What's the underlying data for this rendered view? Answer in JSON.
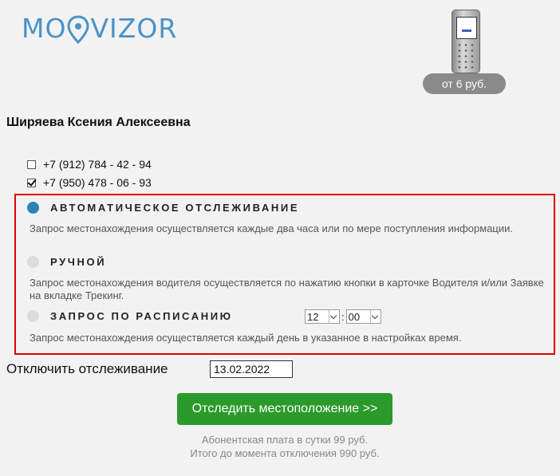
{
  "brand": {
    "logo_text_pre": "MO",
    "logo_text_post": "VIZOR"
  },
  "promo": {
    "price_badge": "от 6 руб."
  },
  "person": {
    "name": "Ширяева Ксения Алексеевна"
  },
  "phones": [
    {
      "number": "+7 (912) 784 - 42 - 94",
      "checked": false
    },
    {
      "number": "+7 (950) 478 - 06 - 93",
      "checked": true
    }
  ],
  "modes": {
    "auto": {
      "title": "АВТОМАТИЧЕСКОЕ ОТСЛЕЖИВАНИЕ",
      "desc": "Запрос местонахождения осуществляется каждые два часа или по мере поступления информации.",
      "selected": true
    },
    "manual": {
      "title": "РУЧНОЙ",
      "desc": "Запрос местонахождения водителя осуществляется по нажатию кнопки в карточке Водителя и/или Заявке на вкладке Трекинг.",
      "selected": false
    },
    "schedule": {
      "title": "ЗАПРОС ПО РАСПИСАНИЮ",
      "desc": "Запрос местонахождения осуществляется каждый день в указанное в настройках время.",
      "selected": false,
      "hour": "12",
      "minute": "00",
      "separator": ":"
    }
  },
  "disable": {
    "label": "Отключить отслеживание",
    "date": "13.02.2022"
  },
  "action": {
    "button_label": "Отследить местоположение >>"
  },
  "fees": {
    "daily": "Абонентская плата в сутки 99 руб.",
    "total": "Итого до момента отключения 990 руб."
  },
  "colors": {
    "accent": "#2e82b8",
    "button": "#2b9a2b",
    "highlight_border": "#e00000",
    "logo": "#4a93c6"
  }
}
